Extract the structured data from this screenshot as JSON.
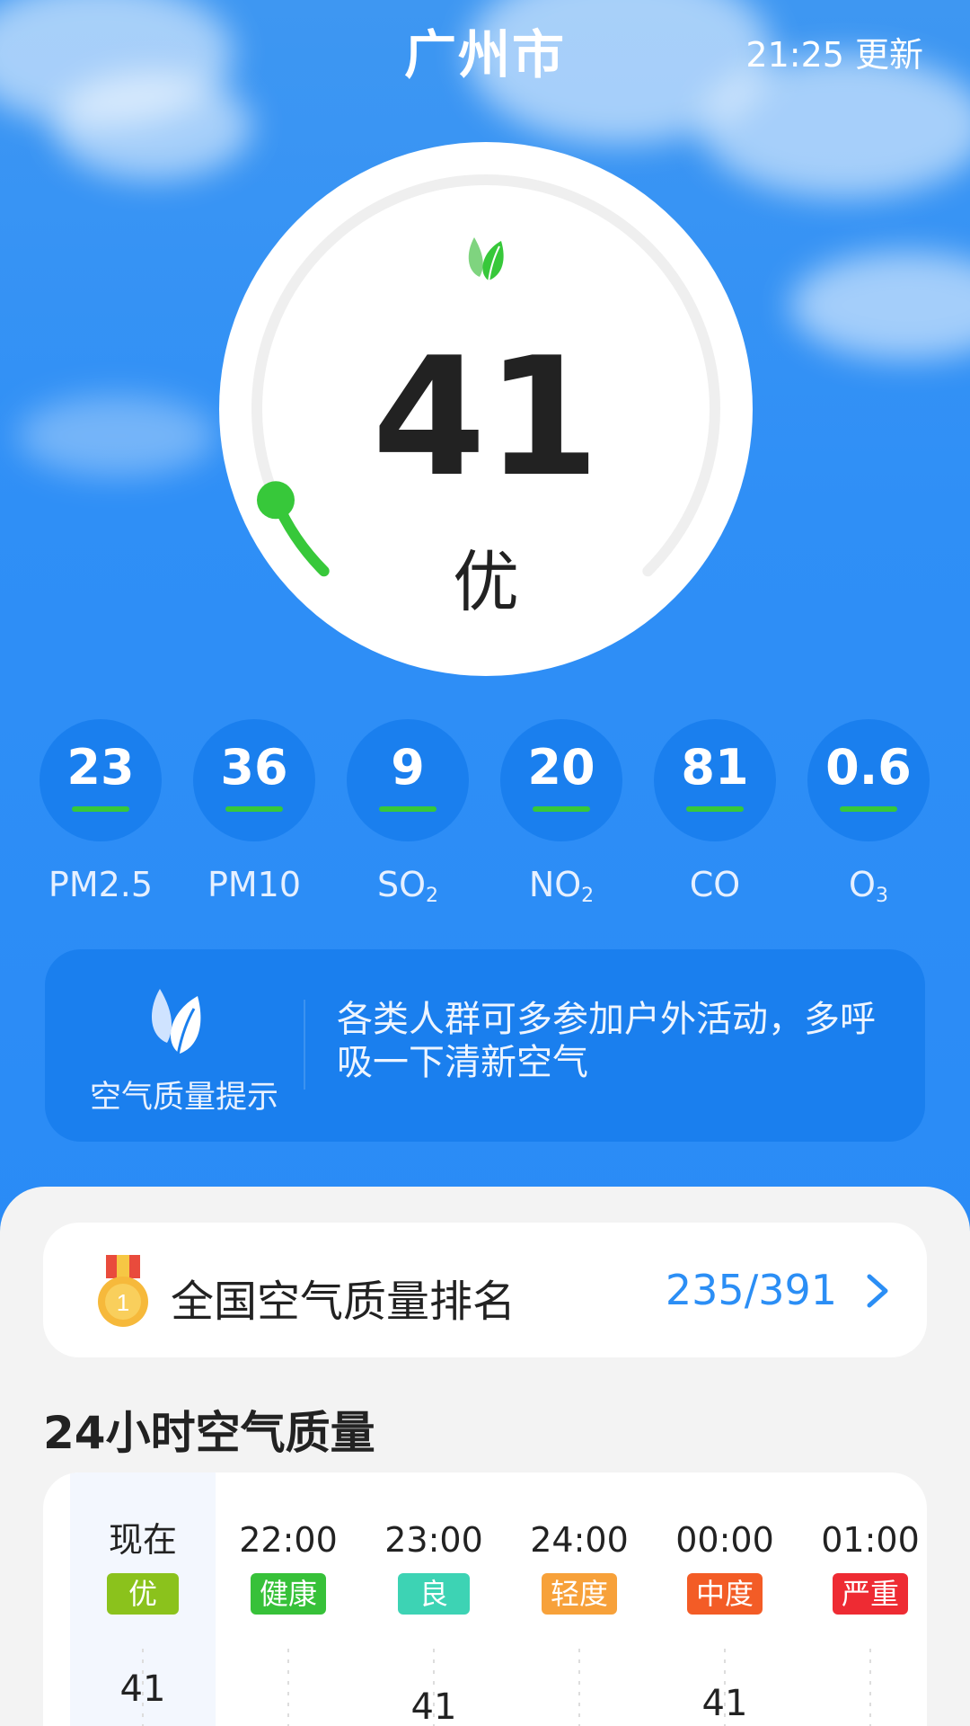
{
  "header": {
    "city": "广州市",
    "update_time": "21:25 更新"
  },
  "aqi": {
    "value": "41",
    "level": "优",
    "gauge_fraction": 0.08
  },
  "pollutants": [
    {
      "value": "23",
      "name": "PM2.5",
      "sub": ""
    },
    {
      "value": "36",
      "name": "PM10",
      "sub": ""
    },
    {
      "value": "9",
      "name": "SO",
      "sub": "2"
    },
    {
      "value": "20",
      "name": "NO",
      "sub": "2"
    },
    {
      "value": "81",
      "name": "CO",
      "sub": ""
    },
    {
      "value": "0.6",
      "name": "O",
      "sub": "3"
    }
  ],
  "tip": {
    "label": "空气质量提示",
    "text": "各类人群可多参加户外活动，多呼吸一下清新空气"
  },
  "ranking": {
    "label": "全国空气质量排名",
    "value": "235/391",
    "medal_number": "1"
  },
  "hourly": {
    "title": "24小时空气质量",
    "items": [
      {
        "time": "现在",
        "badge": "优",
        "color": "#8bc21c",
        "aqi": "41"
      },
      {
        "time": "22:00",
        "badge": "健康",
        "color": "#37c139",
        "aqi": ""
      },
      {
        "time": "23:00",
        "badge": "良",
        "color": "#3dd3b4",
        "aqi": "41"
      },
      {
        "time": "24:00",
        "badge": "轻度",
        "color": "#f7a13a",
        "aqi": ""
      },
      {
        "time": "00:00",
        "badge": "中度",
        "color": "#f35c26",
        "aqi": "41"
      },
      {
        "time": "01:00",
        "badge": "严重",
        "color": "#ee2b33",
        "aqi": ""
      }
    ]
  },
  "colors": {
    "accent_green": "#37c83a",
    "primary_blue": "#2b8ef5",
    "bubble_blue": "#1a7fee"
  }
}
